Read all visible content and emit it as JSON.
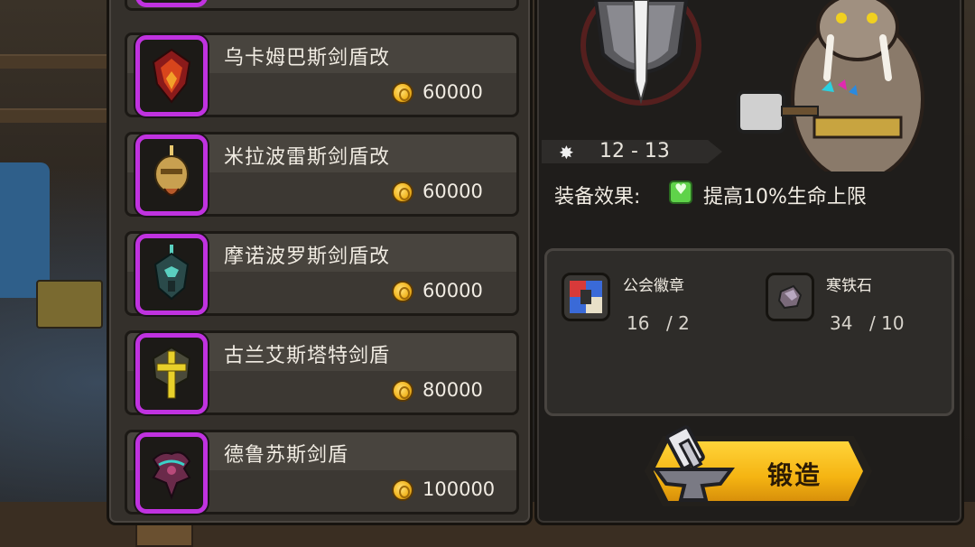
{
  "shop_list": {
    "items": [
      {
        "name": "乌卡姆巴斯剑盾改",
        "price": "60000",
        "icon": "crimson-flame-shield-icon"
      },
      {
        "name": "米拉波雷斯剑盾改",
        "price": "60000",
        "icon": "golden-helm-shield-icon"
      },
      {
        "name": "摩诺波罗斯剑盾改",
        "price": "60000",
        "icon": "teal-dark-knight-shield-icon"
      },
      {
        "name": "古兰艾斯塔特剑盾",
        "price": "80000",
        "icon": "golden-cross-sword-shield-icon"
      },
      {
        "name": "德鲁苏斯剑盾",
        "price": "100000",
        "icon": "violet-dragon-shield-icon"
      }
    ]
  },
  "detail": {
    "damage_range": "12 - 13",
    "effect_label": "装备效果:",
    "effect_text": "提高10%生命上限",
    "materials": [
      {
        "name": "公会徽章",
        "have": "16",
        "need": "/ 2",
        "icon": "guild-badge-icon"
      },
      {
        "name": "寒铁石",
        "have": "34",
        "need": "/ 10",
        "icon": "cold-iron-ore-icon"
      }
    ],
    "forge_label": "锻造"
  },
  "colors": {
    "rarity_frame": "#c032e0",
    "coin": "#f2b51f",
    "forge_button": "#f5b412",
    "panel": "#34302b"
  }
}
